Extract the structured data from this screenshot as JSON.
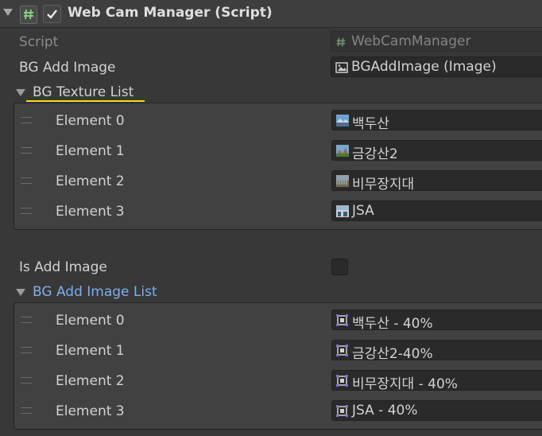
{
  "component": {
    "title": "Web Cam Manager (Script)",
    "enabled": true
  },
  "fields": {
    "script": {
      "label": "Script",
      "value": "WebCamManager"
    },
    "bg_add_image": {
      "label": "BG Add Image",
      "value": "BGAddImage (Image)"
    },
    "is_add_image": {
      "label": "Is Add Image",
      "checked": false
    }
  },
  "bg_texture_list": {
    "label": "BG Texture List",
    "elements": [
      {
        "label": "Element 0",
        "value": "백두산",
        "icon": "texture-icon"
      },
      {
        "label": "Element 1",
        "value": "금강산2",
        "icon": "texture-icon"
      },
      {
        "label": "Element 2",
        "value": "비무장지대",
        "icon": "texture-icon"
      },
      {
        "label": "Element 3",
        "value": "JSA",
        "icon": "texture-icon"
      }
    ]
  },
  "bg_add_image_list": {
    "label": "BG Add Image List",
    "elements": [
      {
        "label": "Element 0",
        "value": "백두산 - 40%",
        "icon": "sprite-icon"
      },
      {
        "label": "Element 1",
        "value": "금강산2-40%",
        "icon": "sprite-icon"
      },
      {
        "label": "Element 2",
        "value": "비무장지대 - 40%",
        "icon": "sprite-icon"
      },
      {
        "label": "Element 3",
        "value": "JSA - 40%",
        "icon": "sprite-icon"
      }
    ]
  },
  "colors": {
    "highlight_underline": "#f2e000",
    "foldout_blue": "#7caff0"
  }
}
